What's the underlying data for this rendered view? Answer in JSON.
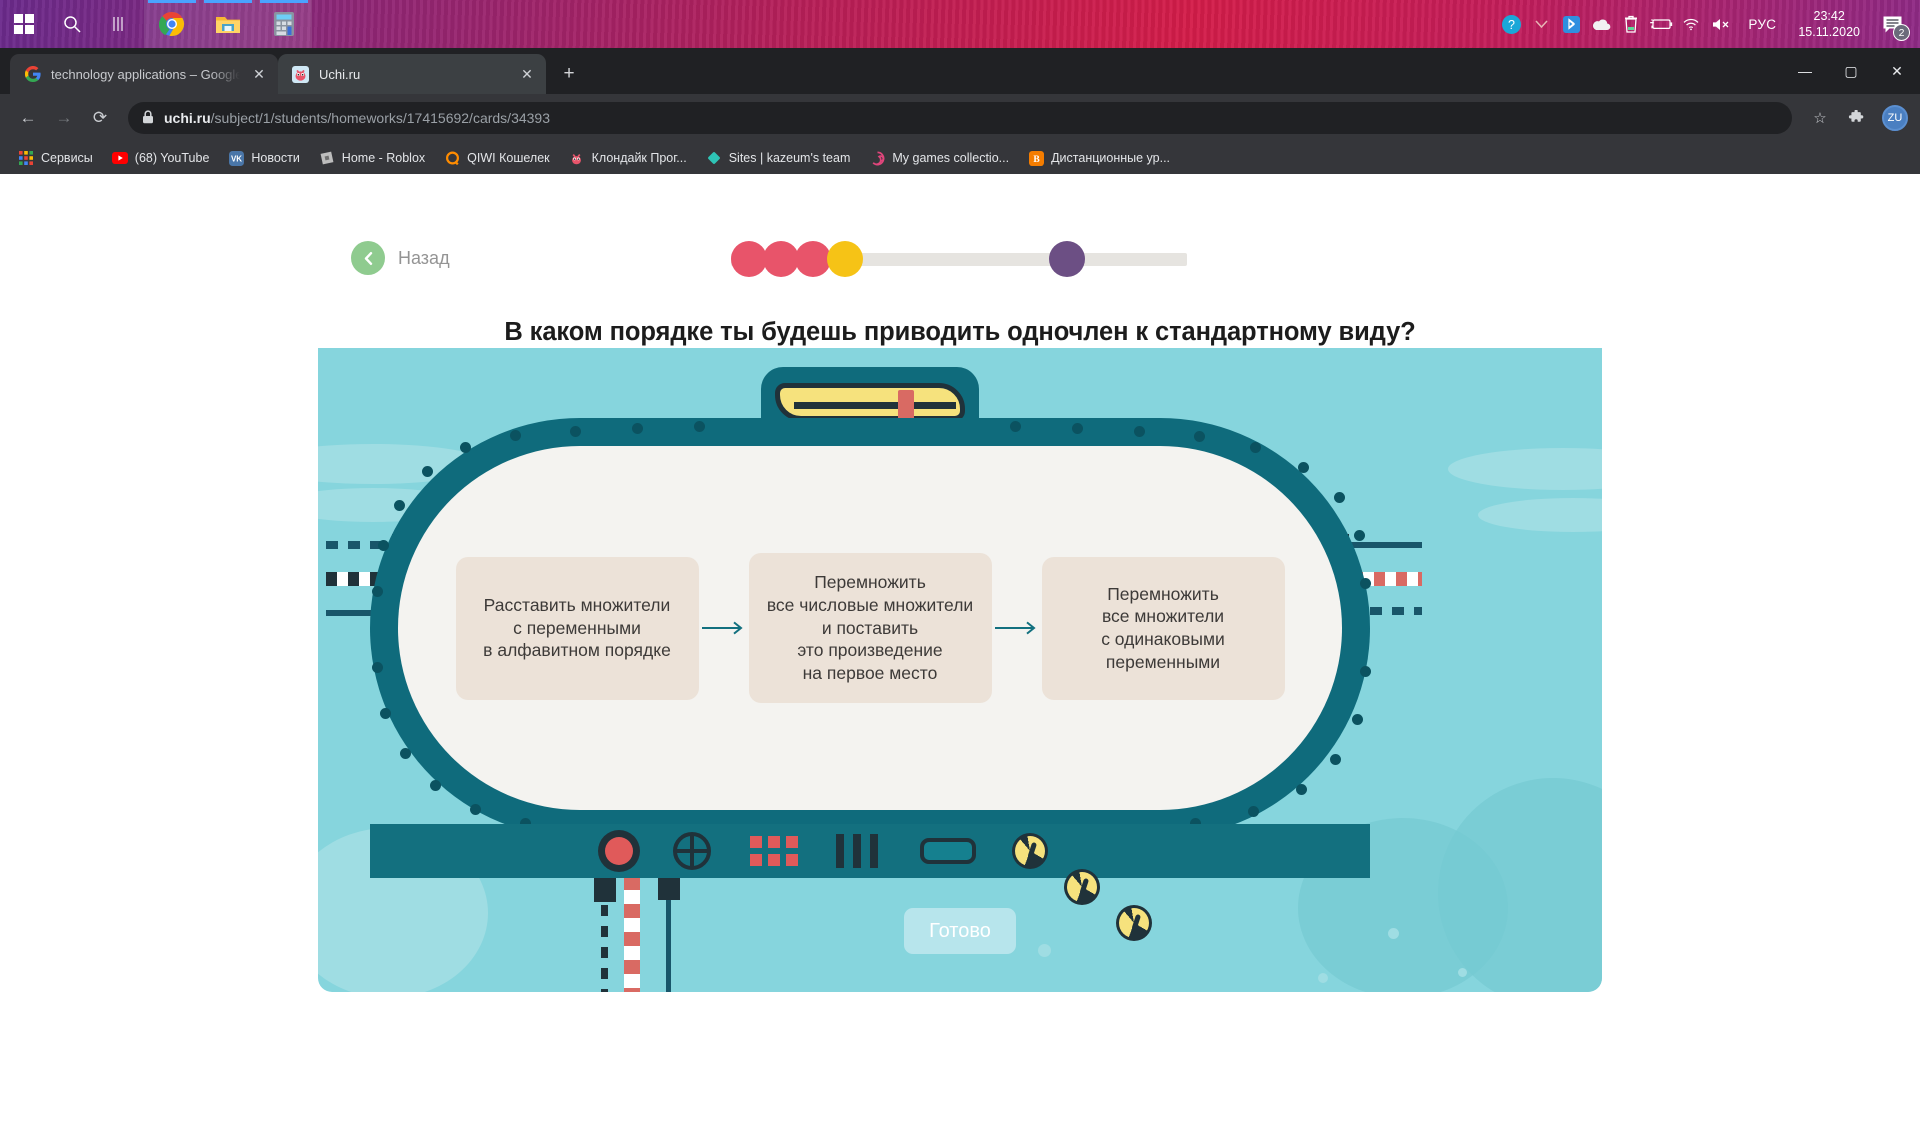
{
  "taskbar": {
    "start_tooltip": "Пуск",
    "search_tooltip": "Поиск",
    "apps": [
      "chrome",
      "file-explorer",
      "calculator"
    ],
    "tray": {
      "language": "РУС",
      "time": "23:42",
      "date": "15.11.2020",
      "notification_count": "2"
    }
  },
  "browser": {
    "tabs": [
      {
        "title": "technology applications – Google",
        "favicon": "G",
        "active": false
      },
      {
        "title": "Uchi.ru",
        "favicon": "U",
        "active": true
      }
    ],
    "new_tab_label": "+",
    "window_controls": {
      "minimize": "—",
      "maximize": "▢",
      "close": "✕"
    },
    "nav": {
      "back": "←",
      "forward": "→",
      "reload": "⟳"
    },
    "url": {
      "lock": "🔒",
      "host": "uchi.ru",
      "path": "/subject/1/students/homeworks/17415692/cards/34393"
    },
    "omnibox_icons": {
      "bookmark": "☆",
      "extensions": "🧩"
    },
    "avatar_initials": "ZU",
    "bookmarks": [
      {
        "label": "Сервисы",
        "icon": "apps-grid"
      },
      {
        "label": "(68) YouTube",
        "icon": "youtube"
      },
      {
        "label": "Новости",
        "icon": "vk"
      },
      {
        "label": "Home - Roblox",
        "icon": "roblox"
      },
      {
        "label": "QIWI Кошелек",
        "icon": "qiwi"
      },
      {
        "label": "Клондайк Прог...",
        "icon": "uchi"
      },
      {
        "label": "Sites | kazeum's team",
        "icon": "diamond"
      },
      {
        "label": "My games collectio...",
        "icon": "spiral"
      },
      {
        "label": "Дистанционные ур...",
        "icon": "blogger"
      }
    ]
  },
  "lesson": {
    "back_label": "Назад",
    "question": "В каком порядке ты будешь приводить одночлен к стандартному виду?",
    "progress": {
      "dots": [
        {
          "color": "#e8546a",
          "position": 0
        },
        {
          "color": "#e8546a",
          "position": 32
        },
        {
          "color": "#e8546a",
          "position": 64
        },
        {
          "color": "#f6c316",
          "position": 96
        },
        {
          "color": "#6c4f84",
          "position": 316
        }
      ],
      "bar_color": "#e6e4e0"
    },
    "answers": [
      {
        "text": "Расставить множители\nс переменными\nв алфавитном порядке"
      },
      {
        "text": "Перемножить\nвсе числовые множители\nи поставить\nэто произведение\nна первое место"
      },
      {
        "text": "Перемножить\nвсе множители\nс одинаковыми\nпеременными"
      }
    ],
    "arrow_glyph": "→",
    "done_label": "Готово",
    "colors": {
      "hull": "#0f6b7c",
      "hull_dark": "#0b5260",
      "water": "#86d5dd",
      "card_bg": "#ece2d8",
      "accent_red": "#d96a63",
      "accent_yellow": "#f6e27d",
      "panel": "#13707f"
    },
    "control_panel": {
      "items": [
        "red-button",
        "crosshair-dial",
        "indicator-grid",
        "lever-bank",
        "screen",
        "gauge",
        "gauge",
        "gauge"
      ]
    }
  }
}
